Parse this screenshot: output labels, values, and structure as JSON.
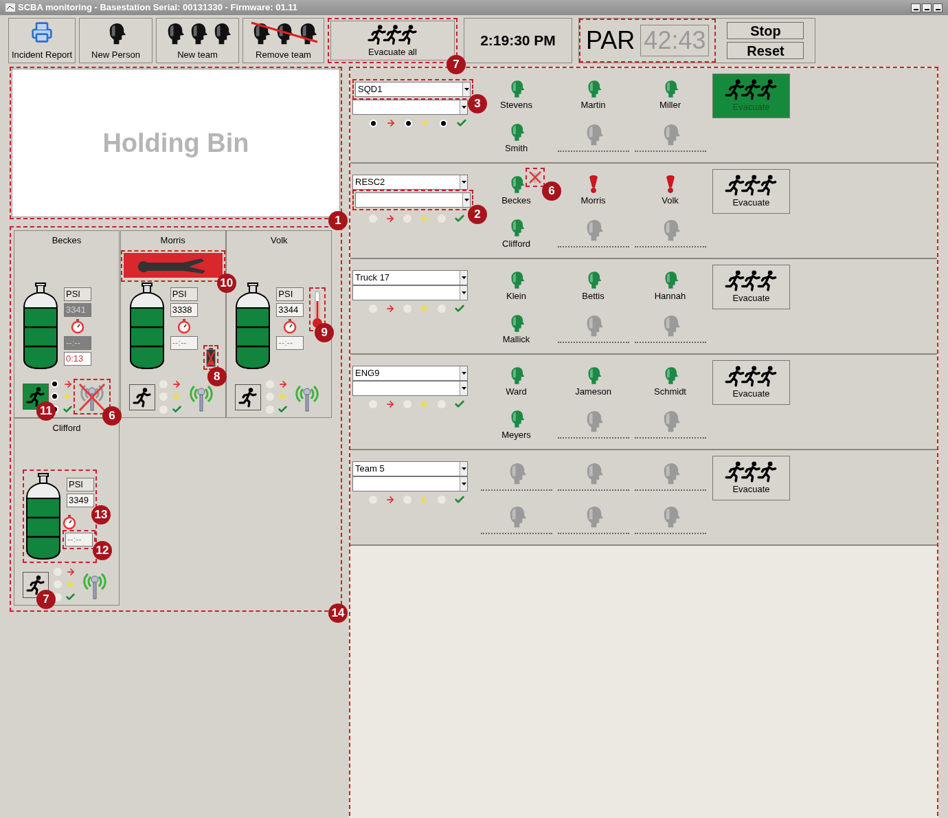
{
  "window": {
    "title": "SCBA monitoring - Basestation Serial: 00131330 - Firmware: 01.11"
  },
  "toolbar": {
    "buttons": [
      {
        "label": "Incident Report",
        "kind": "report"
      },
      {
        "label": "New Person",
        "kind": "person"
      },
      {
        "label": "New team",
        "kind": "team"
      },
      {
        "label": "Remove team",
        "kind": "remove"
      },
      {
        "label": "Evacuate all",
        "kind": "evacuate",
        "callout": "7"
      }
    ],
    "clock": "2:19:30 PM",
    "par": {
      "label": "PAR",
      "timer": "42:43"
    },
    "stop": "Stop",
    "reset": "Reset"
  },
  "holding_bin": {
    "label": "Holding Bin",
    "callout": "1"
  },
  "crew_area": {
    "callout": "14",
    "crew": [
      {
        "name": "Beckes",
        "psi_label": "PSI",
        "psi": "3341",
        "psi_stale": true,
        "timer": "--:--",
        "timer_stale": true,
        "elapsed": "0:13",
        "man_down": false,
        "battery_low": false,
        "heat_alarm": false,
        "evacuating": true,
        "status_lit": true,
        "radio_lost": true,
        "callouts": {
          "evacuate": "11",
          "radio": "6"
        }
      },
      {
        "name": "Morris",
        "psi_label": "PSI",
        "psi": "3338",
        "psi_stale": false,
        "timer": "--:--",
        "timer_stale": false,
        "man_down": true,
        "battery_low": true,
        "heat_alarm": false,
        "evacuating": false,
        "status_lit": false,
        "radio_lost": false,
        "callouts": {
          "man_down": "10",
          "battery": "8"
        }
      },
      {
        "name": "Volk",
        "psi_label": "PSI",
        "psi": "3344",
        "psi_stale": false,
        "timer": "--:--",
        "timer_stale": false,
        "man_down": false,
        "battery_low": false,
        "heat_alarm": true,
        "evacuating": false,
        "status_lit": false,
        "radio_lost": false,
        "callouts": {
          "heat": "9"
        }
      },
      {
        "name": "Clifford",
        "psi_label": "PSI",
        "psi": "3349",
        "psi_stale": false,
        "timer": "--:--",
        "timer_stale": false,
        "man_down": false,
        "battery_low": false,
        "heat_alarm": false,
        "evacuating": false,
        "status_lit": false,
        "radio_lost": false,
        "callouts": {
          "evacuate": "7",
          "psi": "13",
          "timer": "12"
        }
      }
    ]
  },
  "teams": [
    {
      "name": "SQD1",
      "name_callout": "3",
      "status_lit": true,
      "evacuating": true,
      "evacuate_label": "Evacuate",
      "members": [
        {
          "name": "Stevens",
          "kind": "ok"
        },
        {
          "name": "Martin",
          "kind": "ok"
        },
        {
          "name": "Miller",
          "kind": "ok"
        },
        {
          "name": "Smith",
          "kind": "ok"
        },
        {
          "kind": "empty"
        },
        {
          "kind": "empty"
        }
      ]
    },
    {
      "name": "RESC2",
      "sub_callout": "2",
      "status_lit": false,
      "evacuating": false,
      "evacuate_label": "Evacuate",
      "members": [
        {
          "name": "Beckes",
          "kind": "ok",
          "radio_lost": true,
          "callout": "6"
        },
        {
          "name": "Morris",
          "kind": "alarm"
        },
        {
          "name": "Volk",
          "kind": "alarm"
        },
        {
          "name": "Clifford",
          "kind": "ok"
        },
        {
          "kind": "empty"
        },
        {
          "kind": "empty"
        }
      ]
    },
    {
      "name": "Truck 17",
      "status_lit": false,
      "evacuating": false,
      "evacuate_label": "Evacuate",
      "members": [
        {
          "name": "Klein",
          "kind": "ok"
        },
        {
          "name": "Bettis",
          "kind": "ok"
        },
        {
          "name": "Hannah",
          "kind": "ok"
        },
        {
          "name": "Mallick",
          "kind": "ok"
        },
        {
          "kind": "empty"
        },
        {
          "kind": "empty"
        }
      ]
    },
    {
      "name": "ENG9",
      "status_lit": false,
      "evacuating": false,
      "evacuate_label": "Evacuate",
      "members": [
        {
          "name": "Ward",
          "kind": "ok"
        },
        {
          "name": "Jameson",
          "kind": "ok"
        },
        {
          "name": "Schmidt",
          "kind": "ok"
        },
        {
          "name": "Meyers",
          "kind": "ok"
        },
        {
          "kind": "empty"
        },
        {
          "kind": "empty"
        }
      ]
    },
    {
      "name": "Team 5",
      "status_lit": false,
      "evacuating": false,
      "evacuate_label": "Evacuate",
      "members": [
        {
          "kind": "empty"
        },
        {
          "kind": "empty"
        },
        {
          "kind": "empty"
        },
        {
          "kind": "empty"
        },
        {
          "kind": "empty"
        },
        {
          "kind": "empty"
        }
      ]
    }
  ]
}
